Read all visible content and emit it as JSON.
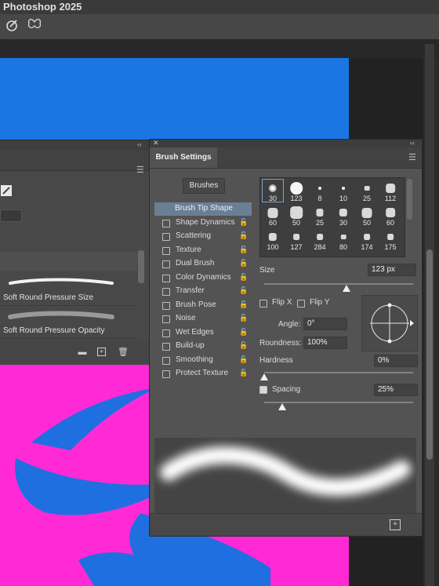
{
  "app": {
    "title": "Photoshop 2025"
  },
  "toolbar": {
    "icons": [
      "brush-gesture-icon",
      "butterfly-icon"
    ]
  },
  "brushes_panel": {
    "items": [
      {
        "label": "Soft Round Pressure Size"
      },
      {
        "label": "Soft Round Pressure Opacity"
      }
    ],
    "footer_icons": [
      "folder-icon",
      "new-brush-icon",
      "trash-icon"
    ]
  },
  "brush_settings": {
    "tab_label": "Brush Settings",
    "brushes_button": "Brushes",
    "options": [
      {
        "label": "Brush Tip Shape",
        "selected": true,
        "checkbox": false,
        "lock": false
      },
      {
        "label": "Shape Dynamics",
        "checkbox": true,
        "lock": true
      },
      {
        "label": "Scattering",
        "checkbox": true,
        "lock": true
      },
      {
        "label": "Texture",
        "checkbox": true,
        "lock": true
      },
      {
        "label": "Dual Brush",
        "checkbox": true,
        "lock": true
      },
      {
        "label": "Color Dynamics",
        "checkbox": true,
        "lock": true
      },
      {
        "label": "Transfer",
        "checkbox": true,
        "lock": true
      },
      {
        "label": "Brush Pose",
        "checkbox": true,
        "lock": true
      },
      {
        "label": "Noise",
        "checkbox": true,
        "lock": true
      },
      {
        "label": "Wet Edges",
        "checkbox": true,
        "lock": true
      },
      {
        "label": "Build-up",
        "checkbox": true,
        "lock": true
      },
      {
        "label": "Smoothing",
        "checkbox": true,
        "lock": true
      },
      {
        "label": "Protect Texture",
        "checkbox": true,
        "lock": true
      }
    ],
    "tips": [
      "30",
      "123",
      "8",
      "10",
      "25",
      "112",
      "60",
      "50",
      "25",
      "30",
      "50",
      "60",
      "100",
      "127",
      "284",
      "80",
      "174",
      "175"
    ],
    "size": {
      "label": "Size",
      "value": "123 px",
      "level": 0.55
    },
    "flip_x": {
      "label": "Flip X"
    },
    "flip_y": {
      "label": "Flip Y"
    },
    "angle": {
      "label": "Angle:",
      "value": "0°"
    },
    "roundness": {
      "label": "Roundness:",
      "value": "100%"
    },
    "hardness": {
      "label": "Hardness",
      "value": "0%",
      "level": 0.0
    },
    "spacing": {
      "label": "Spacing",
      "value": "25%",
      "checked": true,
      "level": 0.12
    }
  },
  "colors": {
    "canvas_blue": "#1976e2",
    "canvas_magenta": "#ff2ad6",
    "selected_option": "#6a7f94"
  }
}
